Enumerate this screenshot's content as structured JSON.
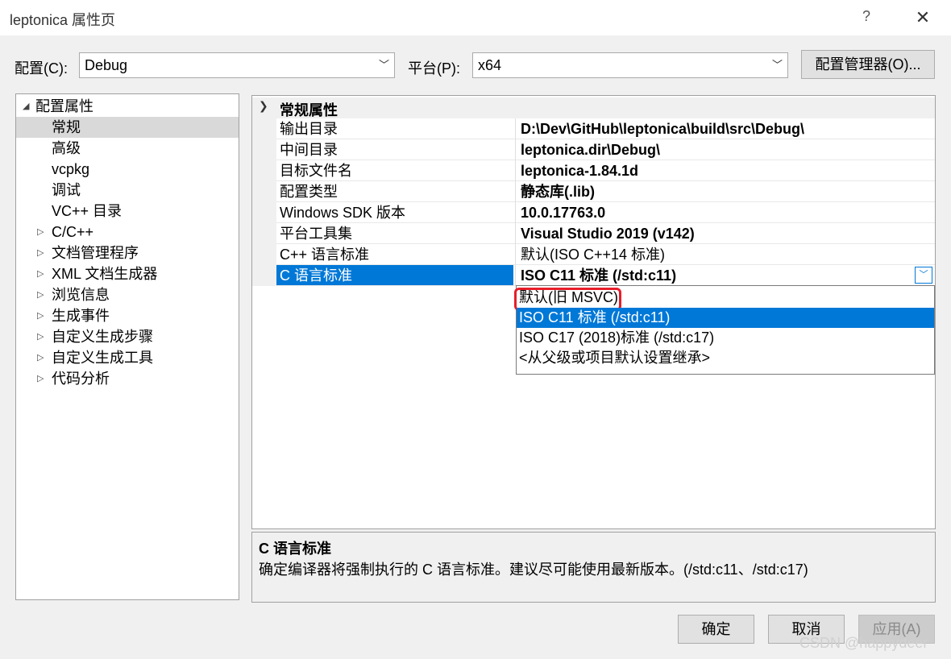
{
  "window": {
    "title": "leptonica 属性页",
    "help_label": "?",
    "close_label": "✕"
  },
  "toolbar": {
    "config_label": "配置(C):",
    "config_value": "Debug",
    "platform_label": "平台(P):",
    "platform_value": "x64",
    "config_manager_label": "配置管理器(O)..."
  },
  "tree": {
    "root": "配置属性",
    "items": [
      "常规",
      "高级",
      "vcpkg",
      "调试",
      "VC++ 目录"
    ],
    "groups": [
      "C/C++",
      "文档管理程序",
      "XML 文档生成器",
      "浏览信息",
      "生成事件",
      "自定义生成步骤",
      "自定义生成工具",
      "代码分析"
    ],
    "selected": "常规"
  },
  "grid": {
    "category": "常规属性",
    "rows": [
      {
        "name": "输出目录",
        "value": "D:\\Dev\\GitHub\\leptonica\\build\\src\\Debug\\"
      },
      {
        "name": "中间目录",
        "value": "leptonica.dir\\Debug\\"
      },
      {
        "name": "目标文件名",
        "value": "leptonica-1.84.1d"
      },
      {
        "name": "配置类型",
        "value": "静态库(.lib)"
      },
      {
        "name": "Windows SDK 版本",
        "value": "10.0.17763.0"
      },
      {
        "name": "平台工具集",
        "value": "Visual Studio 2019 (v142)"
      },
      {
        "name": "C++ 语言标准",
        "value": "默认(ISO C++14 标准)"
      },
      {
        "name": "C 语言标准",
        "value": "ISO C11 标准 (/std:c11)"
      }
    ]
  },
  "dropdown": {
    "options": [
      "默认(旧 MSVC)",
      "ISO C11 标准 (/std:c11)",
      "ISO C17 (2018)标准 (/std:c17)",
      "<从父级或项目默认设置继承>"
    ],
    "selected": "ISO C11 标准 (/std:c11)",
    "highlighted": "默认(旧 MSVC)"
  },
  "description": {
    "title": "C 语言标准",
    "text": "确定编译器将强制执行的 C 语言标准。建议尽可能使用最新版本。(/std:c11、/std:c17)"
  },
  "buttons": {
    "ok": "确定",
    "cancel": "取消",
    "apply": "应用(A)"
  },
  "watermark": "CSDN @happydeer",
  "colors": {
    "selection": "#0078d7",
    "highlight_box": "#e81e2a"
  }
}
